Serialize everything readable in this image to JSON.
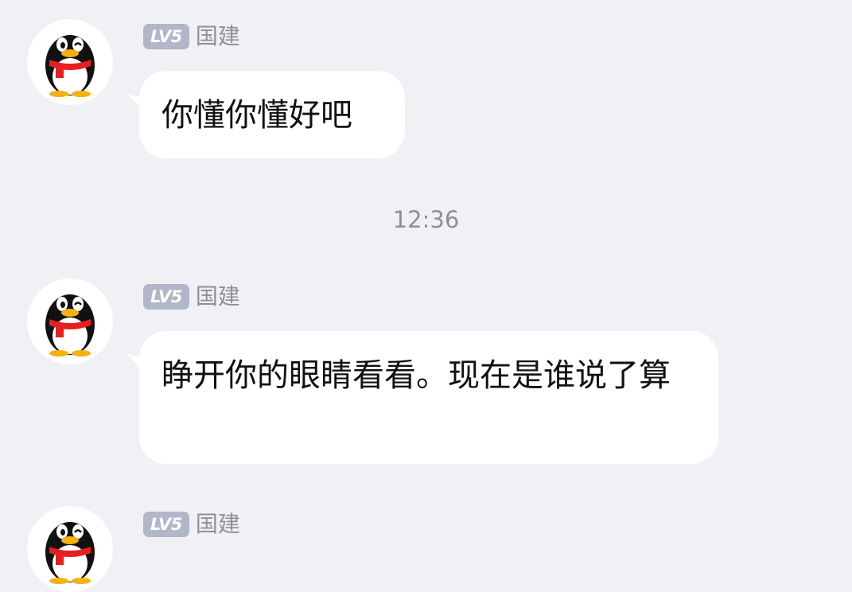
{
  "messages": [
    {
      "sender": {
        "level": "LV5",
        "name": "国建"
      },
      "avatar_icon": "qq-penguin-icon",
      "text": "你懂你懂好吧"
    },
    {
      "sender": {
        "level": "LV5",
        "name": "国建"
      },
      "avatar_icon": "qq-penguin-icon",
      "text": "睁开你的眼睛看看。现在是谁说了算"
    },
    {
      "sender": {
        "level": "LV5",
        "name": "国建"
      },
      "avatar_icon": "qq-penguin-icon",
      "text": ""
    }
  ],
  "timestamp": "12:36",
  "colors": {
    "background": "#f1f1f5",
    "bubble": "#ffffff",
    "badge": "#b1b6c9",
    "muted_text": "#8d8f99"
  }
}
